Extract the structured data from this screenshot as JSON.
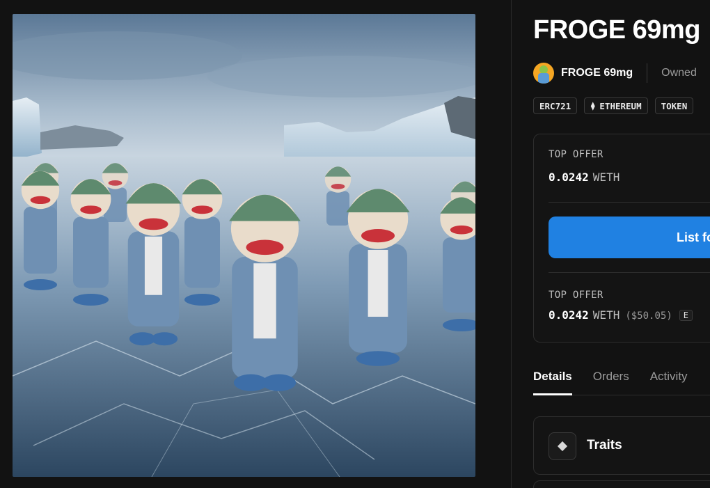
{
  "artwork": {
    "alt": "FROGE 69mg",
    "palette": {
      "sky_top": "#5b7896",
      "sky_bottom": "#c9d6e2",
      "ice": "#9bb4c9",
      "ice_dark": "#2c4660",
      "jacket": "#6f90b3",
      "beanie": "#5e8a6e",
      "face": "#e9dccb",
      "lips": "#c9323a"
    }
  },
  "header": {
    "title": "FROGE 69mg"
  },
  "owner_row": {
    "collection_name": "FROGE 69mg",
    "owned_text": "Owned"
  },
  "chips": {
    "standard": "ERC721",
    "chain_icon": "ethereum-icon",
    "chain": "ETHEREUM",
    "token": "TOKEN"
  },
  "offer_card": {
    "top_offer_label": "TOP OFFER",
    "top_offer_amount": "0.0242",
    "top_offer_currency": "WETH",
    "list_button_label": "List fo",
    "second_offer_label": "TOP OFFER",
    "second_offer_amount": "0.0242",
    "second_offer_currency": "WETH",
    "second_offer_usd": "($50.05)",
    "second_offer_badge": "E"
  },
  "tabs": [
    {
      "label": "Details",
      "active": true
    },
    {
      "label": "Orders",
      "active": false
    },
    {
      "label": "Activity",
      "active": false
    }
  ],
  "traits": {
    "icon": "diamond-icon",
    "label": "Traits"
  },
  "colors": {
    "background": "#121212",
    "accent": "#2081e2",
    "border": "#2e2e2e",
    "muted_text": "#9a9a9a"
  }
}
